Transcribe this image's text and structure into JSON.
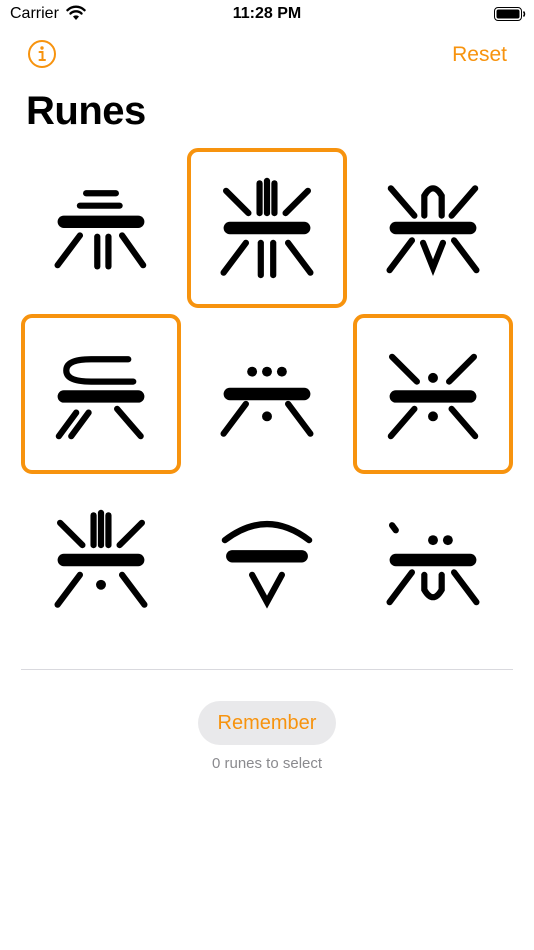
{
  "status_bar": {
    "carrier": "Carrier",
    "time": "11:28 PM",
    "battery_level": 1.0
  },
  "nav": {
    "info_icon": "info-circle-icon",
    "reset_label": "Reset"
  },
  "page": {
    "title": "Runes"
  },
  "runes": [
    {
      "id": "rune-1",
      "selected": false
    },
    {
      "id": "rune-2",
      "selected": true
    },
    {
      "id": "rune-3",
      "selected": false
    },
    {
      "id": "rune-4",
      "selected": true
    },
    {
      "id": "rune-5",
      "selected": false
    },
    {
      "id": "rune-6",
      "selected": true
    },
    {
      "id": "rune-7",
      "selected": false
    },
    {
      "id": "rune-8",
      "selected": false
    },
    {
      "id": "rune-9",
      "selected": false
    }
  ],
  "footer": {
    "remember_label": "Remember",
    "select_count_text": "0 runes to select"
  },
  "colors": {
    "accent": "#F7930E",
    "button_bg": "#e9e9eb",
    "secondary_text": "#8a8a8e"
  }
}
